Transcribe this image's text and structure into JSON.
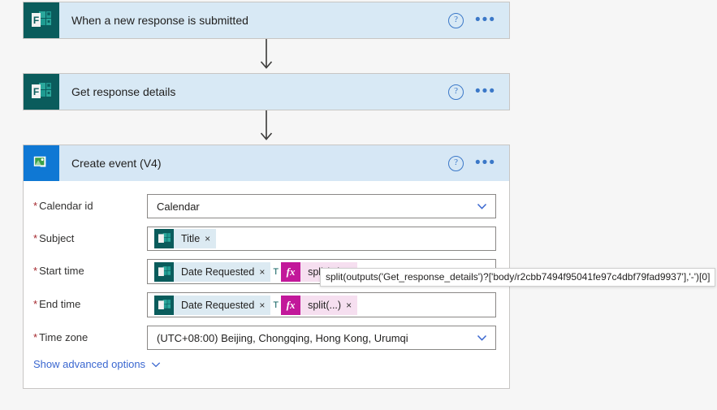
{
  "flow": {
    "steps": [
      {
        "id": "when-a-new-response-is-submitted",
        "title": "When a new response is submitted",
        "connector": "microsoft-forms",
        "help_label": "?",
        "menu_label": "•••"
      },
      {
        "id": "get-response-details",
        "title": "Get response details",
        "connector": "microsoft-forms",
        "help_label": "?",
        "menu_label": "•••"
      },
      {
        "id": "create-event-v4",
        "title": "Create event (V4)",
        "connector": "office-365-outlook",
        "help_label": "?",
        "menu_label": "•••"
      }
    ]
  },
  "create_event": {
    "fields": {
      "calendar_id": {
        "label": "Calendar id",
        "required_marker": "*",
        "value": "Calendar",
        "type": "dropdown"
      },
      "subject": {
        "label": "Subject",
        "required_marker": "*",
        "type": "tokens",
        "tokens": [
          {
            "kind": "dynamic",
            "label": "Title",
            "icon": "forms-icon",
            "remove_label": "×"
          }
        ]
      },
      "start_time": {
        "label": "Start time",
        "required_marker": "*",
        "type": "tokens",
        "separator": "T",
        "tokens": [
          {
            "kind": "dynamic",
            "label": "Date Requested",
            "icon": "forms-icon",
            "remove_label": "×"
          },
          {
            "kind": "expression",
            "label": "split(...)",
            "icon": "fx-icon",
            "remove_label": "×"
          }
        ]
      },
      "end_time": {
        "label": "End time",
        "required_marker": "*",
        "type": "tokens",
        "separator": "T",
        "tokens": [
          {
            "kind": "dynamic",
            "label": "Date Requested",
            "icon": "forms-icon",
            "remove_label": "×"
          },
          {
            "kind": "expression",
            "label": "split(...)",
            "icon": "fx-icon",
            "remove_label": "×"
          }
        ]
      },
      "time_zone": {
        "label": "Time zone",
        "required_marker": "*",
        "value": "(UTC+08:00) Beijing, Chongqing, Hong Kong, Urumqi",
        "type": "dropdown"
      }
    },
    "advanced_options_link": "Show advanced options"
  },
  "tooltip": {
    "text": "split(outputs('Get_response_details')?['body/r2cbb7494f95041fe97c4dbf79fad9937'],'-')[0]"
  },
  "colors": {
    "card_header": "#d8e9f5",
    "forms_tile": "#0a5c5c",
    "outlook_tile": "#0f78d4",
    "dynamic_token": "#dceaf2",
    "expression_token": "#f6dff0",
    "fx_chip": "#c2189a",
    "required_star": "#a4262c",
    "link": "#3a67d0",
    "canvas": "#f6f6f6"
  }
}
